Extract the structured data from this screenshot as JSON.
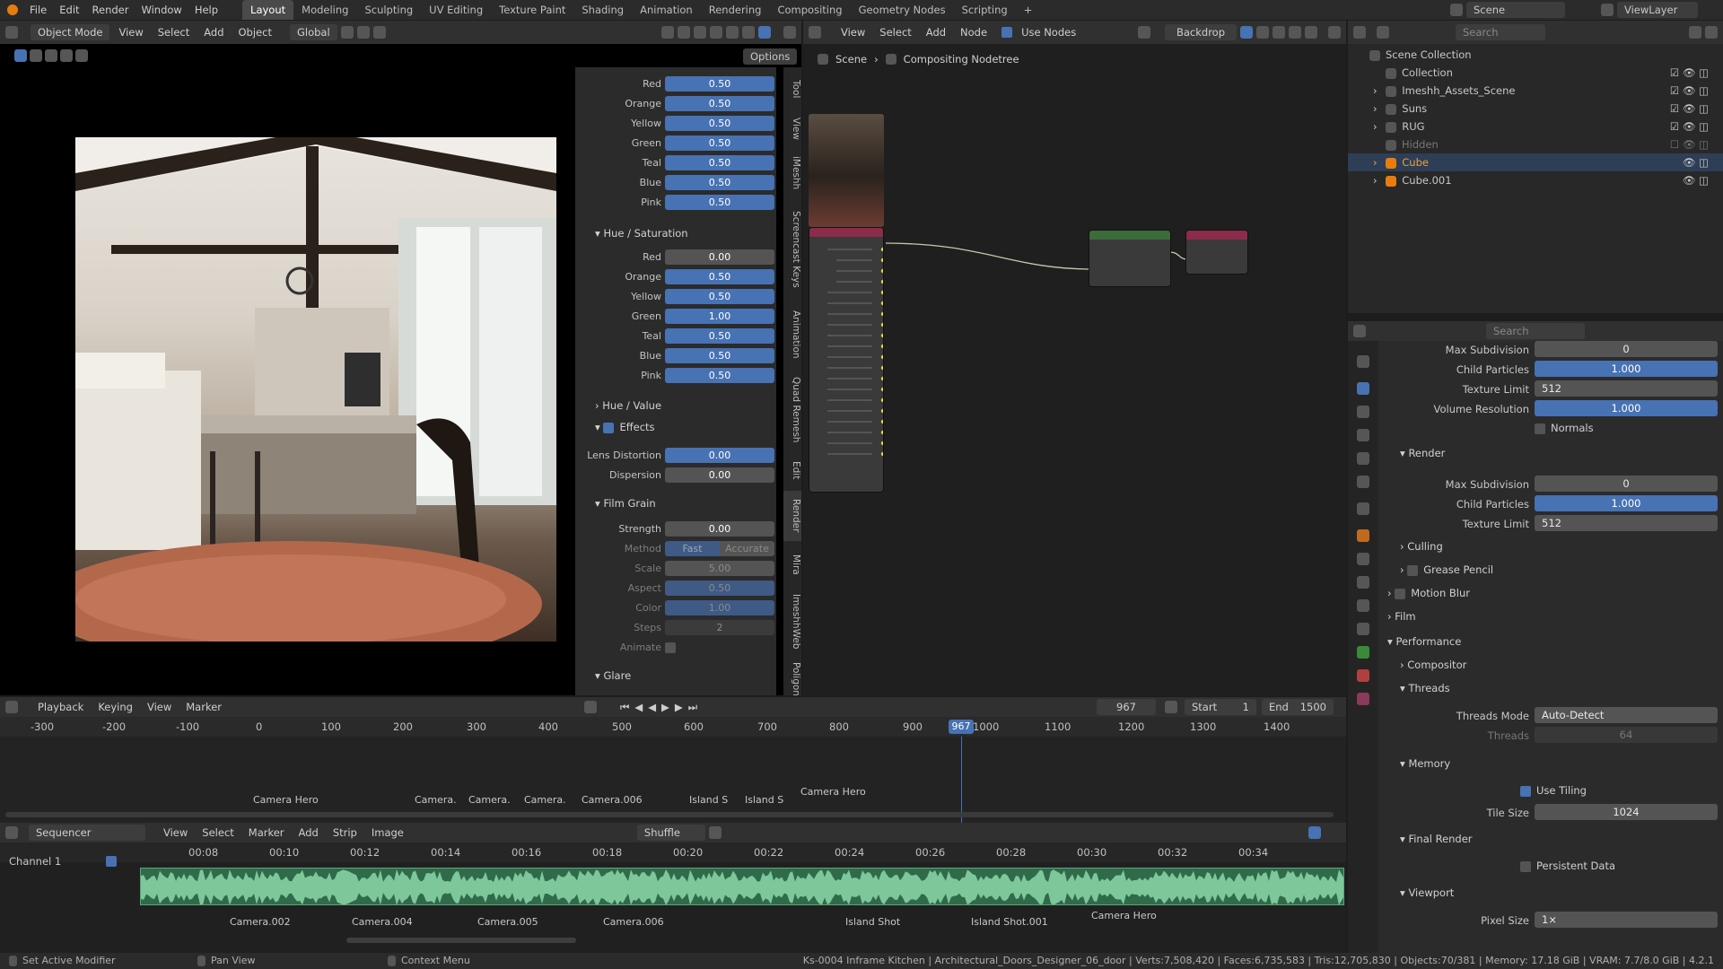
{
  "topbar": {
    "menus": [
      "File",
      "Edit",
      "Render",
      "Window",
      "Help"
    ],
    "workspaces": [
      "Layout",
      "Modeling",
      "Sculpting",
      "UV Editing",
      "Texture Paint",
      "Shading",
      "Animation",
      "Rendering",
      "Compositing",
      "Geometry Nodes",
      "Scripting"
    ],
    "active_workspace": "Layout",
    "scene": "Scene",
    "view_layer": "ViewLayer"
  },
  "viewport_header": {
    "mode": "Object Mode",
    "menus": [
      "View",
      "Select",
      "Add",
      "Object"
    ],
    "transform": "Global",
    "options": "Options"
  },
  "color_panel": {
    "top_rows": [
      {
        "label": "Red",
        "value": "0.50"
      },
      {
        "label": "Orange",
        "value": "0.50"
      },
      {
        "label": "Yellow",
        "value": "0.50"
      },
      {
        "label": "Green",
        "value": "0.50"
      },
      {
        "label": "Teal",
        "value": "0.50"
      },
      {
        "label": "Blue",
        "value": "0.50"
      },
      {
        "label": "Pink",
        "value": "0.50"
      }
    ],
    "hue_sat_title": "Hue / Saturation",
    "hue_sat_rows": [
      {
        "label": "Red",
        "value": "0.00"
      },
      {
        "label": "Orange",
        "value": "0.50"
      },
      {
        "label": "Yellow",
        "value": "0.50"
      },
      {
        "label": "Green",
        "value": "1.00"
      },
      {
        "label": "Teal",
        "value": "0.50"
      },
      {
        "label": "Blue",
        "value": "0.50"
      },
      {
        "label": "Pink",
        "value": "0.50"
      }
    ],
    "hue_value_title": "Hue / Value",
    "effects_title": "Effects",
    "lens_distortion": {
      "label": "Lens Distortion",
      "value": "0.00"
    },
    "dispersion": {
      "label": "Dispersion",
      "value": "0.00"
    },
    "film_grain_title": "Film Grain",
    "strength": {
      "label": "Strength",
      "value": "0.00"
    },
    "method": {
      "label": "Method",
      "opt1": "Fast",
      "opt2": "Accurate"
    },
    "scale": {
      "label": "Scale",
      "value": "5.00"
    },
    "aspect": {
      "label": "Aspect",
      "value": "0.50"
    },
    "color": {
      "label": "Color",
      "value": "1.00"
    },
    "steps": {
      "label": "Steps",
      "value": "2"
    },
    "animate": {
      "label": "Animate"
    },
    "glare_title": "Glare"
  },
  "side_tabs": [
    "Tool",
    "View",
    "iMeshh",
    "Screencast Keys",
    "Animation",
    "Quad Remesh",
    "Edit",
    "Render",
    "Mira",
    "ImeshhWeb",
    "Poligon"
  ],
  "compositor_header": {
    "menus": [
      "View",
      "Select",
      "Add",
      "Node"
    ],
    "use_nodes": "Use Nodes",
    "backdrop": "Backdrop",
    "breadcrumb_scene": "Scene",
    "breadcrumb_tree": "Compositing Nodetree"
  },
  "outliner": {
    "search_placeholder": "Search",
    "root": "Scene Collection",
    "items": [
      {
        "name": "Collection"
      },
      {
        "name": "Imeshh_Assets_Scene"
      },
      {
        "name": "Suns"
      },
      {
        "name": "RUG"
      },
      {
        "name": "Hidden"
      },
      {
        "name": "Cube"
      },
      {
        "name": "Cube.001"
      }
    ]
  },
  "properties": {
    "search_placeholder": "Search",
    "viewport_rows": [
      {
        "label": "Max Subdivision",
        "value": "0"
      },
      {
        "label": "Child Particles",
        "value": "1.000"
      },
      {
        "label": "Texture Limit",
        "value": "512"
      },
      {
        "label": "Volume Resolution",
        "value": "1.000"
      }
    ],
    "normals": "Normals",
    "render_title": "Render",
    "render_rows": [
      {
        "label": "Max Subdivision",
        "value": "0"
      },
      {
        "label": "Child Particles",
        "value": "1.000"
      },
      {
        "label": "Texture Limit",
        "value": "512"
      }
    ],
    "culling": "Culling",
    "grease_pencil": "Grease Pencil",
    "motion_blur": "Motion Blur",
    "film": "Film",
    "performance": "Performance",
    "compositor": "Compositor",
    "threads": "Threads",
    "threads_mode": {
      "label": "Threads Mode",
      "value": "Auto-Detect"
    },
    "threads_count": {
      "label": "Threads",
      "value": "64"
    },
    "memory": "Memory",
    "use_tiling": "Use Tiling",
    "tile_size": {
      "label": "Tile Size",
      "value": "1024"
    },
    "final_render": "Final Render",
    "persistent_data": "Persistent Data",
    "viewport_title": "Viewport",
    "pixel_size": {
      "label": "Pixel Size",
      "value": "1×"
    }
  },
  "timeline": {
    "menus": [
      "Playback",
      "Keying",
      "View",
      "Marker"
    ],
    "current_frame": "967",
    "start_label": "Start",
    "start": "1",
    "end_label": "End",
    "end": "1500",
    "ticks": [
      "-300",
      "-200",
      "-100",
      "0",
      "100",
      "200",
      "300",
      "400",
      "500",
      "600",
      "700",
      "800",
      "900",
      "1000",
      "1100",
      "1200",
      "1300",
      "1400"
    ],
    "markers": [
      "Camera Hero",
      "Camera.",
      "Camera.",
      "Camera.",
      "Camera.006",
      "Island S",
      "Island S",
      "Camera Hero"
    ]
  },
  "sequencer": {
    "mode": "Sequencer",
    "menus": [
      "View",
      "Select",
      "Marker",
      "Add",
      "Strip",
      "Image"
    ],
    "shuffle": "Shuffle",
    "channel": "Channel 1",
    "ticks": [
      "00:08",
      "00:10",
      "00:12",
      "00:14",
      "00:16",
      "00:18",
      "00:20",
      "00:22",
      "00:24",
      "00:26",
      "00:28",
      "00:30",
      "00:32",
      "00:34"
    ],
    "markers": [
      "Camera.002",
      "Camera.004",
      "Camera.005",
      "Camera.006",
      "Island Shot",
      "Island Shot.001",
      "Camera Hero"
    ]
  },
  "statusbar": {
    "left1": "Set Active Modifier",
    "left2": "Pan View",
    "left3": "Context Menu",
    "stats": "Ks-0004 Inframe Kitchen | Architectural_Doors_Designer_06_door | Verts:7,508,420 | Faces:6,735,583 | Tris:12,705,830 | Objects:70/381 | Memory: 17.18 GiB | VRAM: 7.7/8.0 GiB | 4.2.1"
  }
}
